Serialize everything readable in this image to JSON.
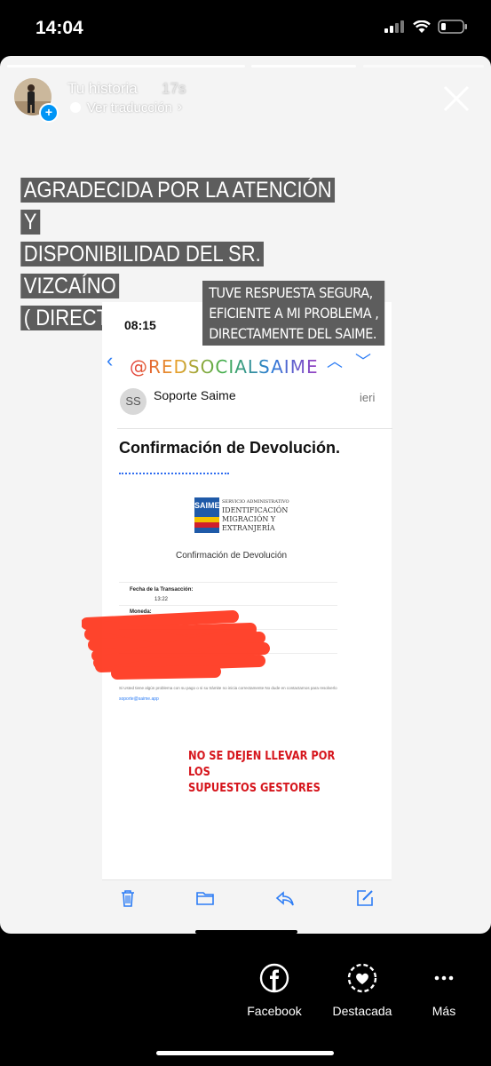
{
  "status_bar": {
    "time": "14:04"
  },
  "story": {
    "user_name": "Tu historia",
    "time_ago": "17s",
    "translate_label": "Ver traducción",
    "caption_main": [
      "AGRADECIDA POR LA ATENCIÓN Y",
      "DISPONIBILIDAD DEL SR. VIZCAÍNO",
      "( DIRECTOR SAIME)"
    ],
    "caption_side": [
      "TUVE RESPUESTA SEGURA,",
      "EFICIENTE A MI PROBLEMA ,",
      "DIRECTAMENTE DEL SAIME."
    ],
    "handle": "@REDSOCIALSAIME",
    "warning": [
      "NO SE DEJEN LLEVAR POR LOS",
      "SUPUESTOS GESTORES"
    ]
  },
  "email": {
    "time": "08:15",
    "sender_initials": "SS",
    "sender_name": "Soporte Saime",
    "sender_extra": "ieri",
    "subject": "Confirmación de Devolución.",
    "logo_mark": "SAIME",
    "logo_lines": [
      "SERVICIO ADMINISTRATIVO",
      "IDENTIFICACIÓN",
      "MIGRACIÓN Y",
      "EXTRANJERÍA"
    ],
    "doc_title": "Confirmación de Devolución",
    "date_label": "Fecha de la Transacción:",
    "date_value": "13:22",
    "money_label": "Moneda:",
    "footer_note": "Si Usted tiene algún problema con su pago o si su trámite no inicia correctamente No dude en contactarnos para resolverlo",
    "footer_email": "soporte@saime.app"
  },
  "actions": [
    {
      "label": "Facebook",
      "icon": "facebook-icon"
    },
    {
      "label": "Destacada",
      "icon": "highlight-heart-icon"
    },
    {
      "label": "Más",
      "icon": "more-icon"
    }
  ],
  "colors": {
    "caption_bg": "#5d5d5d",
    "warning": "#d6161d",
    "accent_blue": "#2d7df5",
    "scribble": "#ff3b22"
  }
}
